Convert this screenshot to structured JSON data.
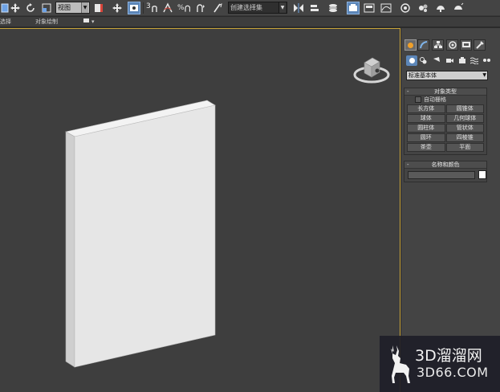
{
  "toolbar": {
    "view_dropdown": "视图",
    "selection_set_dropdown": "创建选择集",
    "snap_3": "3",
    "percent_snap": "%"
  },
  "subbar": {
    "left_label": "选择",
    "object_paint_label": "对象绘制",
    "arrow": "▾"
  },
  "panel": {
    "category_dropdown": "标准基本体",
    "object_type": {
      "title": "对象类型",
      "collapse": "-",
      "autogrid": "自动栅格",
      "buttons": [
        "长方体",
        "圆锥体",
        "球体",
        "几何球体",
        "圆柱体",
        "管状体",
        "圆环",
        "四棱锥",
        "茶壶",
        "平面"
      ]
    },
    "name_color": {
      "title": "名称和颜色",
      "collapse": "-",
      "name_value": "",
      "swatch_color": "#ffffff"
    }
  },
  "watermark": {
    "brand": "3D溜溜网",
    "url": "3D66.COM"
  },
  "colors": {
    "viewport_bg": "#3e3e3e",
    "viewport_border": "#c9a43a",
    "active_blue": "#5c86b8",
    "box_front": "#e6e6e6",
    "box_side": "#cfcfcf",
    "box_top": "#f4f4f4"
  }
}
